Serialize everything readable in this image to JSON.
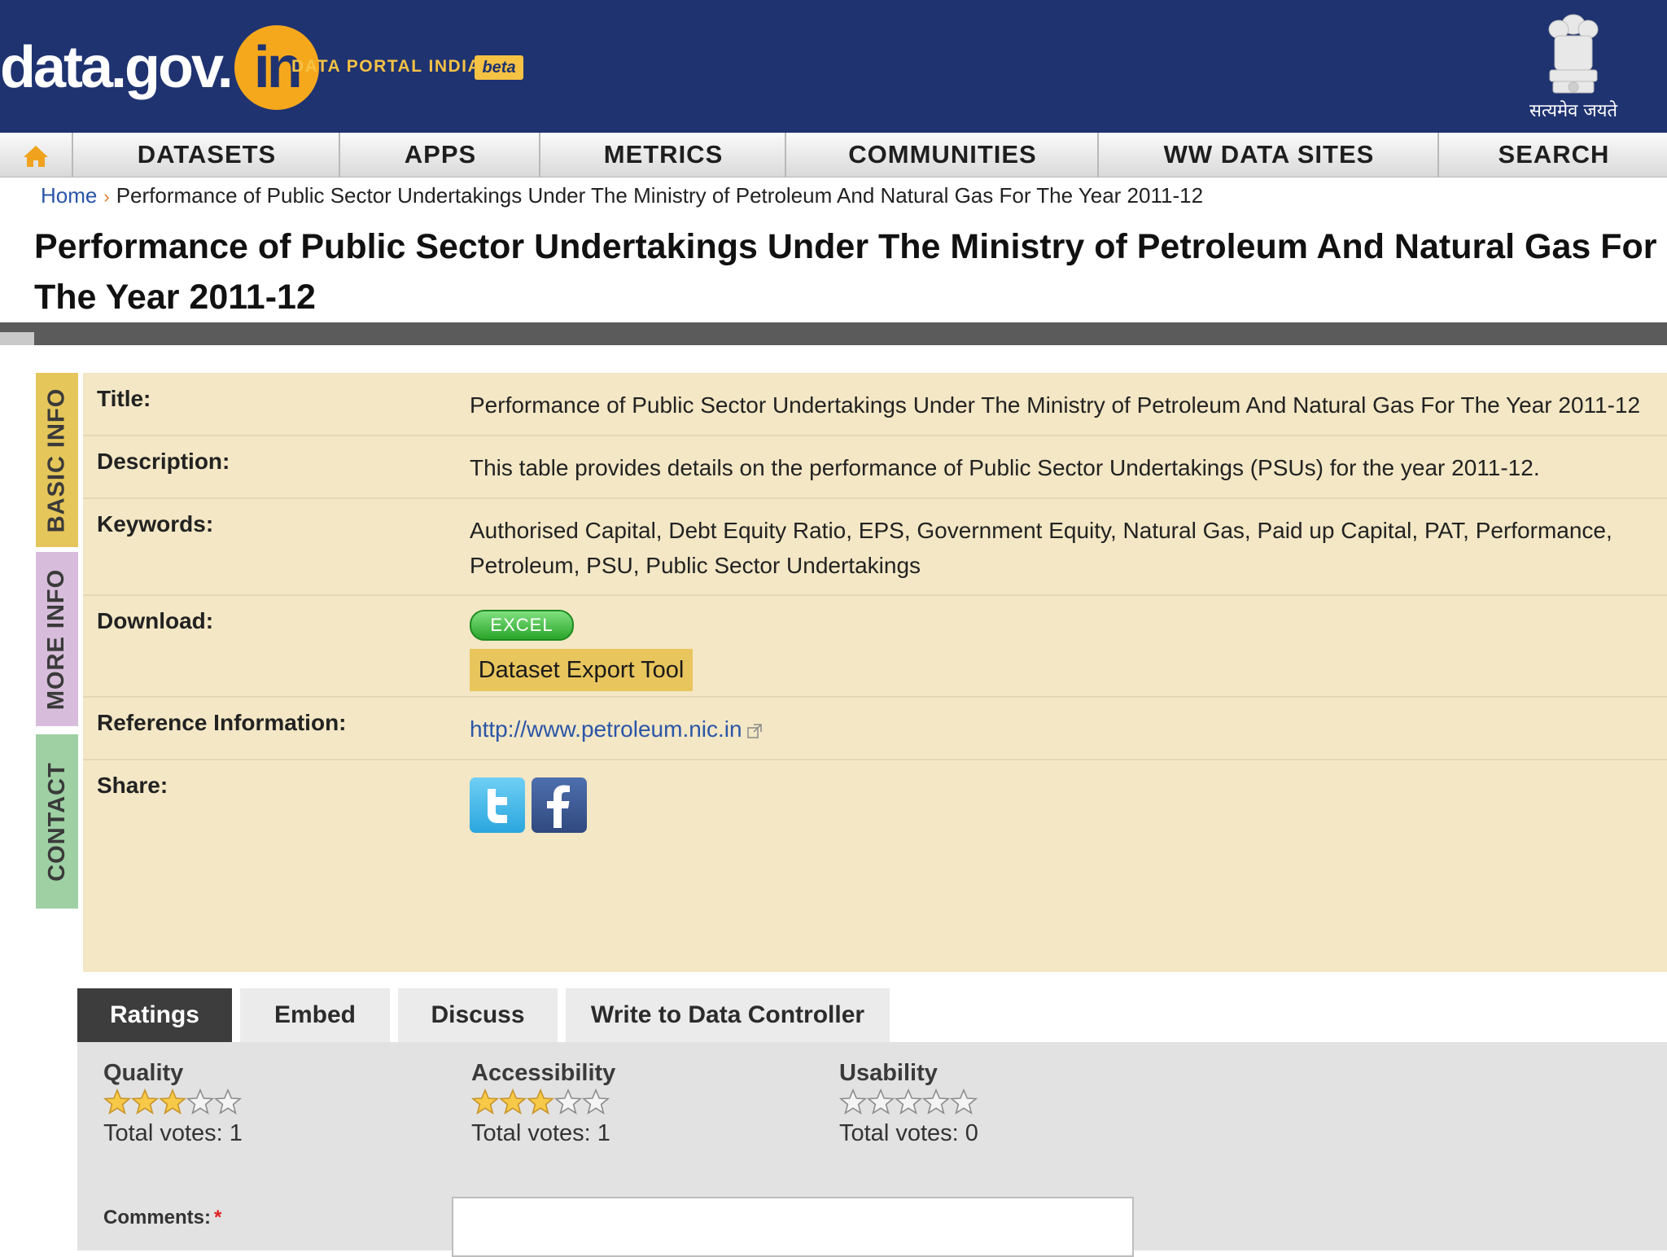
{
  "header": {
    "logo_data": "data.gov.",
    "logo_in": "in",
    "tagline": "DATA PORTAL INDIA",
    "beta": "beta",
    "emblem_text": "सत्यमेव जयते"
  },
  "nav": {
    "home_icon": "home-icon",
    "items": [
      "DATASETS",
      "APPS",
      "METRICS",
      "COMMUNITIES",
      "WW DATA SITES",
      "SEARCH"
    ]
  },
  "breadcrumb": {
    "home": "Home",
    "separator": "›",
    "current": "Performance of Public Sector Undertakings Under The Ministry of Petroleum And Natural Gas For The Year 2011-12"
  },
  "page": {
    "title": "Performance of Public Sector Undertakings Under The Ministry of Petroleum And Natural Gas For The Year 2011-12"
  },
  "side_tabs": [
    "BASIC INFO",
    "MORE INFO",
    "CONTACT"
  ],
  "info": {
    "title_label": "Title:",
    "title_value": "Performance of Public Sector Undertakings Under The Ministry of Petroleum And Natural Gas For The Year 2011-12",
    "description_label": "Description:",
    "description_value": "This table provides details on the performance of Public Sector Undertakings (PSUs) for the year 2011-12.",
    "keywords_label": "Keywords:",
    "keywords_value": "Authorised Capital, Debt Equity Ratio, EPS, Government Equity, Natural Gas, Paid up Capital, PAT, Performance, Petroleum, PSU, Public Sector Undertakings",
    "download_label": "Download:",
    "excel_button": "EXCEL",
    "export_tool": "Dataset Export Tool",
    "reference_label": "Reference Information:",
    "reference_link": "http://www.petroleum.nic.in",
    "share_label": "Share:",
    "share_icons": [
      "twitter-icon",
      "facebook-icon"
    ]
  },
  "bottom_tabs": [
    "Ratings",
    "Embed",
    "Discuss",
    "Write to Data Controller"
  ],
  "active_tab": "Ratings",
  "ratings": [
    {
      "label": "Quality",
      "stars": 3,
      "max": 5,
      "votes": "Total votes: 1"
    },
    {
      "label": "Accessibility",
      "stars": 3,
      "max": 5,
      "votes": "Total votes: 1"
    },
    {
      "label": "Usability",
      "stars": 0,
      "max": 5,
      "votes": "Total votes: 0"
    }
  ],
  "comments": {
    "label": "Comments:",
    "required_mark": "*"
  },
  "colors": {
    "header_bg": "#1f3371",
    "logo_accent": "#f6a81c",
    "panel_bg": "#f3e7c5",
    "basic_info_tab": "#e5c65a",
    "more_info_tab": "#d7bddb",
    "contact_tab": "#9ed0a4",
    "link": "#2a55a8",
    "active_tab_bg": "#3d3d3d"
  }
}
